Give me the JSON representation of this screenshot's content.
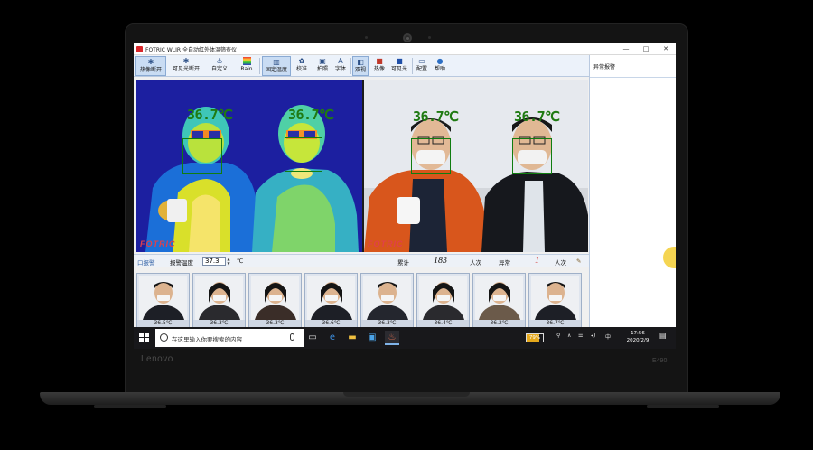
{
  "window": {
    "title": "FOTRIC WLIR 全自动红外体温筛查仪",
    "controls": [
      "—",
      "□",
      "✕"
    ]
  },
  "toolbar": {
    "items": [
      {
        "label": "热像断开",
        "icon": "✱",
        "active": true
      },
      {
        "label": "可见光断开",
        "icon": "✱",
        "active": false
      },
      {
        "label": "自定义",
        "icon": "⚓",
        "active": false
      },
      {
        "label": "Rain",
        "icon": "▤",
        "active": false
      },
      {
        "label": "固定温度",
        "icon": "▥",
        "active": true
      },
      {
        "label": "校准",
        "icon": "✿",
        "active": false
      },
      {
        "label": "拍照",
        "icon": "▣",
        "active": false
      },
      {
        "label": "字体",
        "icon": "A",
        "active": false
      },
      {
        "label": "双视",
        "icon": "◧",
        "active": true
      },
      {
        "label": "热像",
        "icon": "■",
        "active": false
      },
      {
        "label": "可见光",
        "icon": "■",
        "active": false
      },
      {
        "label": "配置",
        "icon": "▭",
        "active": false
      },
      {
        "label": "帮助",
        "icon": "●",
        "active": false
      }
    ]
  },
  "sidepanel": {
    "title": "异常报警"
  },
  "video": {
    "thermal_labels": [
      "36.7℃",
      "36.7℃"
    ],
    "visible_labels": [
      "36.7℃",
      "36.7℃"
    ],
    "watermark": "FOTRIC"
  },
  "stats": {
    "tab_label": "口报警",
    "alarm_temp_label": "报警温度",
    "alarm_temp_value": "37.3",
    "alarm_temp_unit": "℃",
    "total_label": "累计",
    "total_value": "183",
    "total_unit": "人次",
    "abnormal_label": "异常",
    "abnormal_value": "1",
    "abnormal_unit": "人次"
  },
  "thumbnails": [
    {
      "temp": "36.5℃"
    },
    {
      "temp": "36.3℃"
    },
    {
      "temp": "36.3℃"
    },
    {
      "temp": "36.6℃"
    },
    {
      "temp": "36.3℃"
    },
    {
      "temp": "36.4℃"
    },
    {
      "temp": "36.2℃"
    },
    {
      "temp": "36.7℃"
    }
  ],
  "taskbar": {
    "search_placeholder": "在这里输入你要搜索的内容",
    "battery": "79%",
    "ime": "中",
    "time": "17:56",
    "date": "2020/2/9"
  },
  "device": {
    "brand": "Lenovo",
    "model": "E490"
  },
  "colors": {
    "temp_text": "#1f7a12",
    "accent": "#c9dcf3",
    "taskbar": "#18181b"
  }
}
